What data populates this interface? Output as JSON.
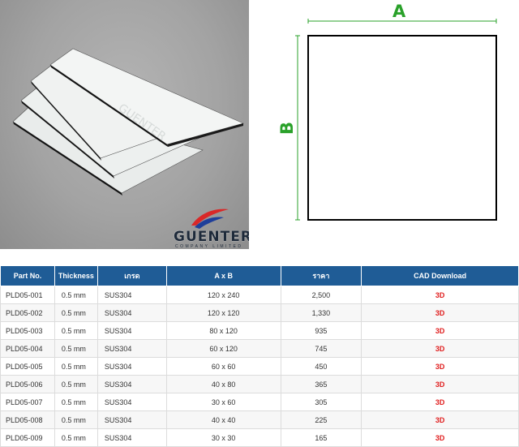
{
  "logo": {
    "name": "GUENTER",
    "tagline": "COMPANY LIMITED"
  },
  "diagram": {
    "label_a": "A",
    "label_b": "B",
    "line_color": "#2aa12a"
  },
  "table": {
    "header_color": "#1f5c96",
    "link_color": "#e02020",
    "headers": [
      "Part No.",
      "Thickness",
      "เกรด",
      "A x B",
      "ราคา",
      "CAD Download"
    ],
    "rows": [
      [
        "PLD05-001",
        "0.5 mm",
        "SUS304",
        "120 x 240",
        "2,500",
        "3D"
      ],
      [
        "PLD05-002",
        "0.5 mm",
        "SUS304",
        "120 x 120",
        "1,330",
        "3D"
      ],
      [
        "PLD05-003",
        "0.5 mm",
        "SUS304",
        "80 x 120",
        "935",
        "3D"
      ],
      [
        "PLD05-004",
        "0.5 mm",
        "SUS304",
        "60 x 120",
        "745",
        "3D"
      ],
      [
        "PLD05-005",
        "0.5 mm",
        "SUS304",
        "60 x 60",
        "450",
        "3D"
      ],
      [
        "PLD05-006",
        "0.5 mm",
        "SUS304",
        "40 x 80",
        "365",
        "3D"
      ],
      [
        "PLD05-007",
        "0.5 mm",
        "SUS304",
        "30 x 60",
        "305",
        "3D"
      ],
      [
        "PLD05-008",
        "0.5 mm",
        "SUS304",
        "40 x 40",
        "225",
        "3D"
      ],
      [
        "PLD05-009",
        "0.5 mm",
        "SUS304",
        "30 x 30",
        "165",
        "3D"
      ]
    ]
  }
}
